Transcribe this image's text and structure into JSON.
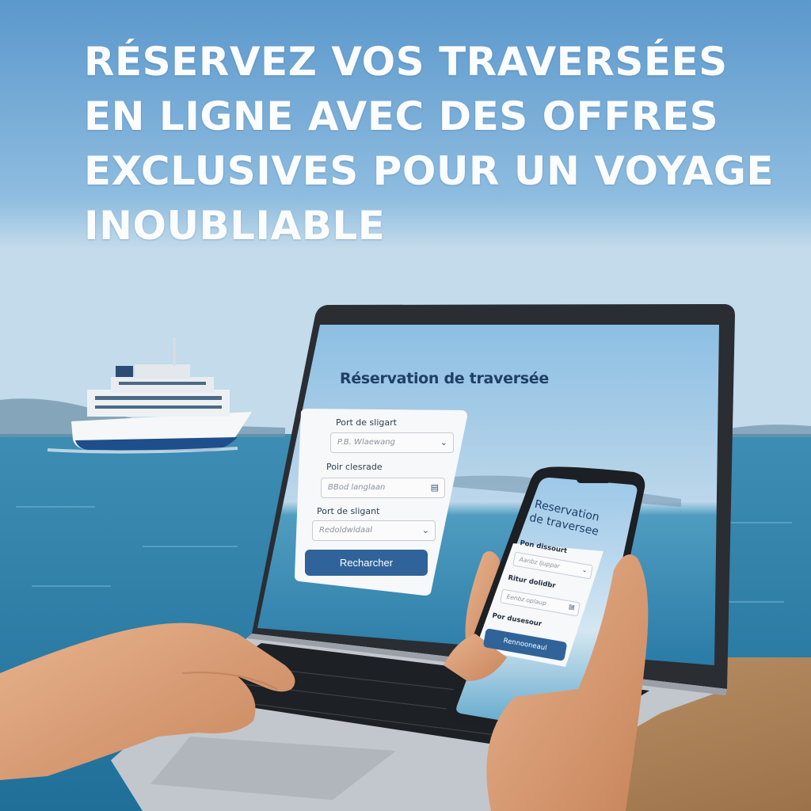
{
  "headline": {
    "lines": [
      "RÉSERVEZ VOS TRAVERSÉES",
      "EN LIGNE AVEC DES OFFRES",
      "EXCLUSIVES POUR UN VOYAGE",
      "INOUBLIABLE"
    ]
  },
  "laptop_form": {
    "title": "Réservation de traversée",
    "fields": [
      {
        "label": "Port de sligart",
        "placeholder": "P.B. Wlaewang",
        "icon": "chevron-down-icon"
      },
      {
        "label": "Poir clesrade",
        "placeholder": "BBod langlaan",
        "icon": "calendar-icon"
      },
      {
        "label": "Port de sligant",
        "placeholder": "Redoldwldaal",
        "icon": "chevron-down-icon"
      }
    ],
    "button_label": "Recharcher"
  },
  "phone_form": {
    "title_line1": "Reservation",
    "title_line2": "de traversee",
    "fields": [
      {
        "label": "Pon dissourt",
        "placeholder": "Aanbz ljuppar",
        "icon": "chevron-down-icon"
      },
      {
        "label": "Ritur dolidbr",
        "placeholder": "Eenbz oplaup",
        "icon": "calendar-icon"
      },
      {
        "label": "Por dusesour",
        "placeholder": "",
        "icon": ""
      }
    ],
    "button_label": "Rennooneaul"
  },
  "colors": {
    "sky": "#6fa8d6",
    "sea": "#2e7fa6",
    "accent_button": "#2f639a",
    "title_navy": "#1f3f66",
    "table_wood": "#b48a5f"
  }
}
